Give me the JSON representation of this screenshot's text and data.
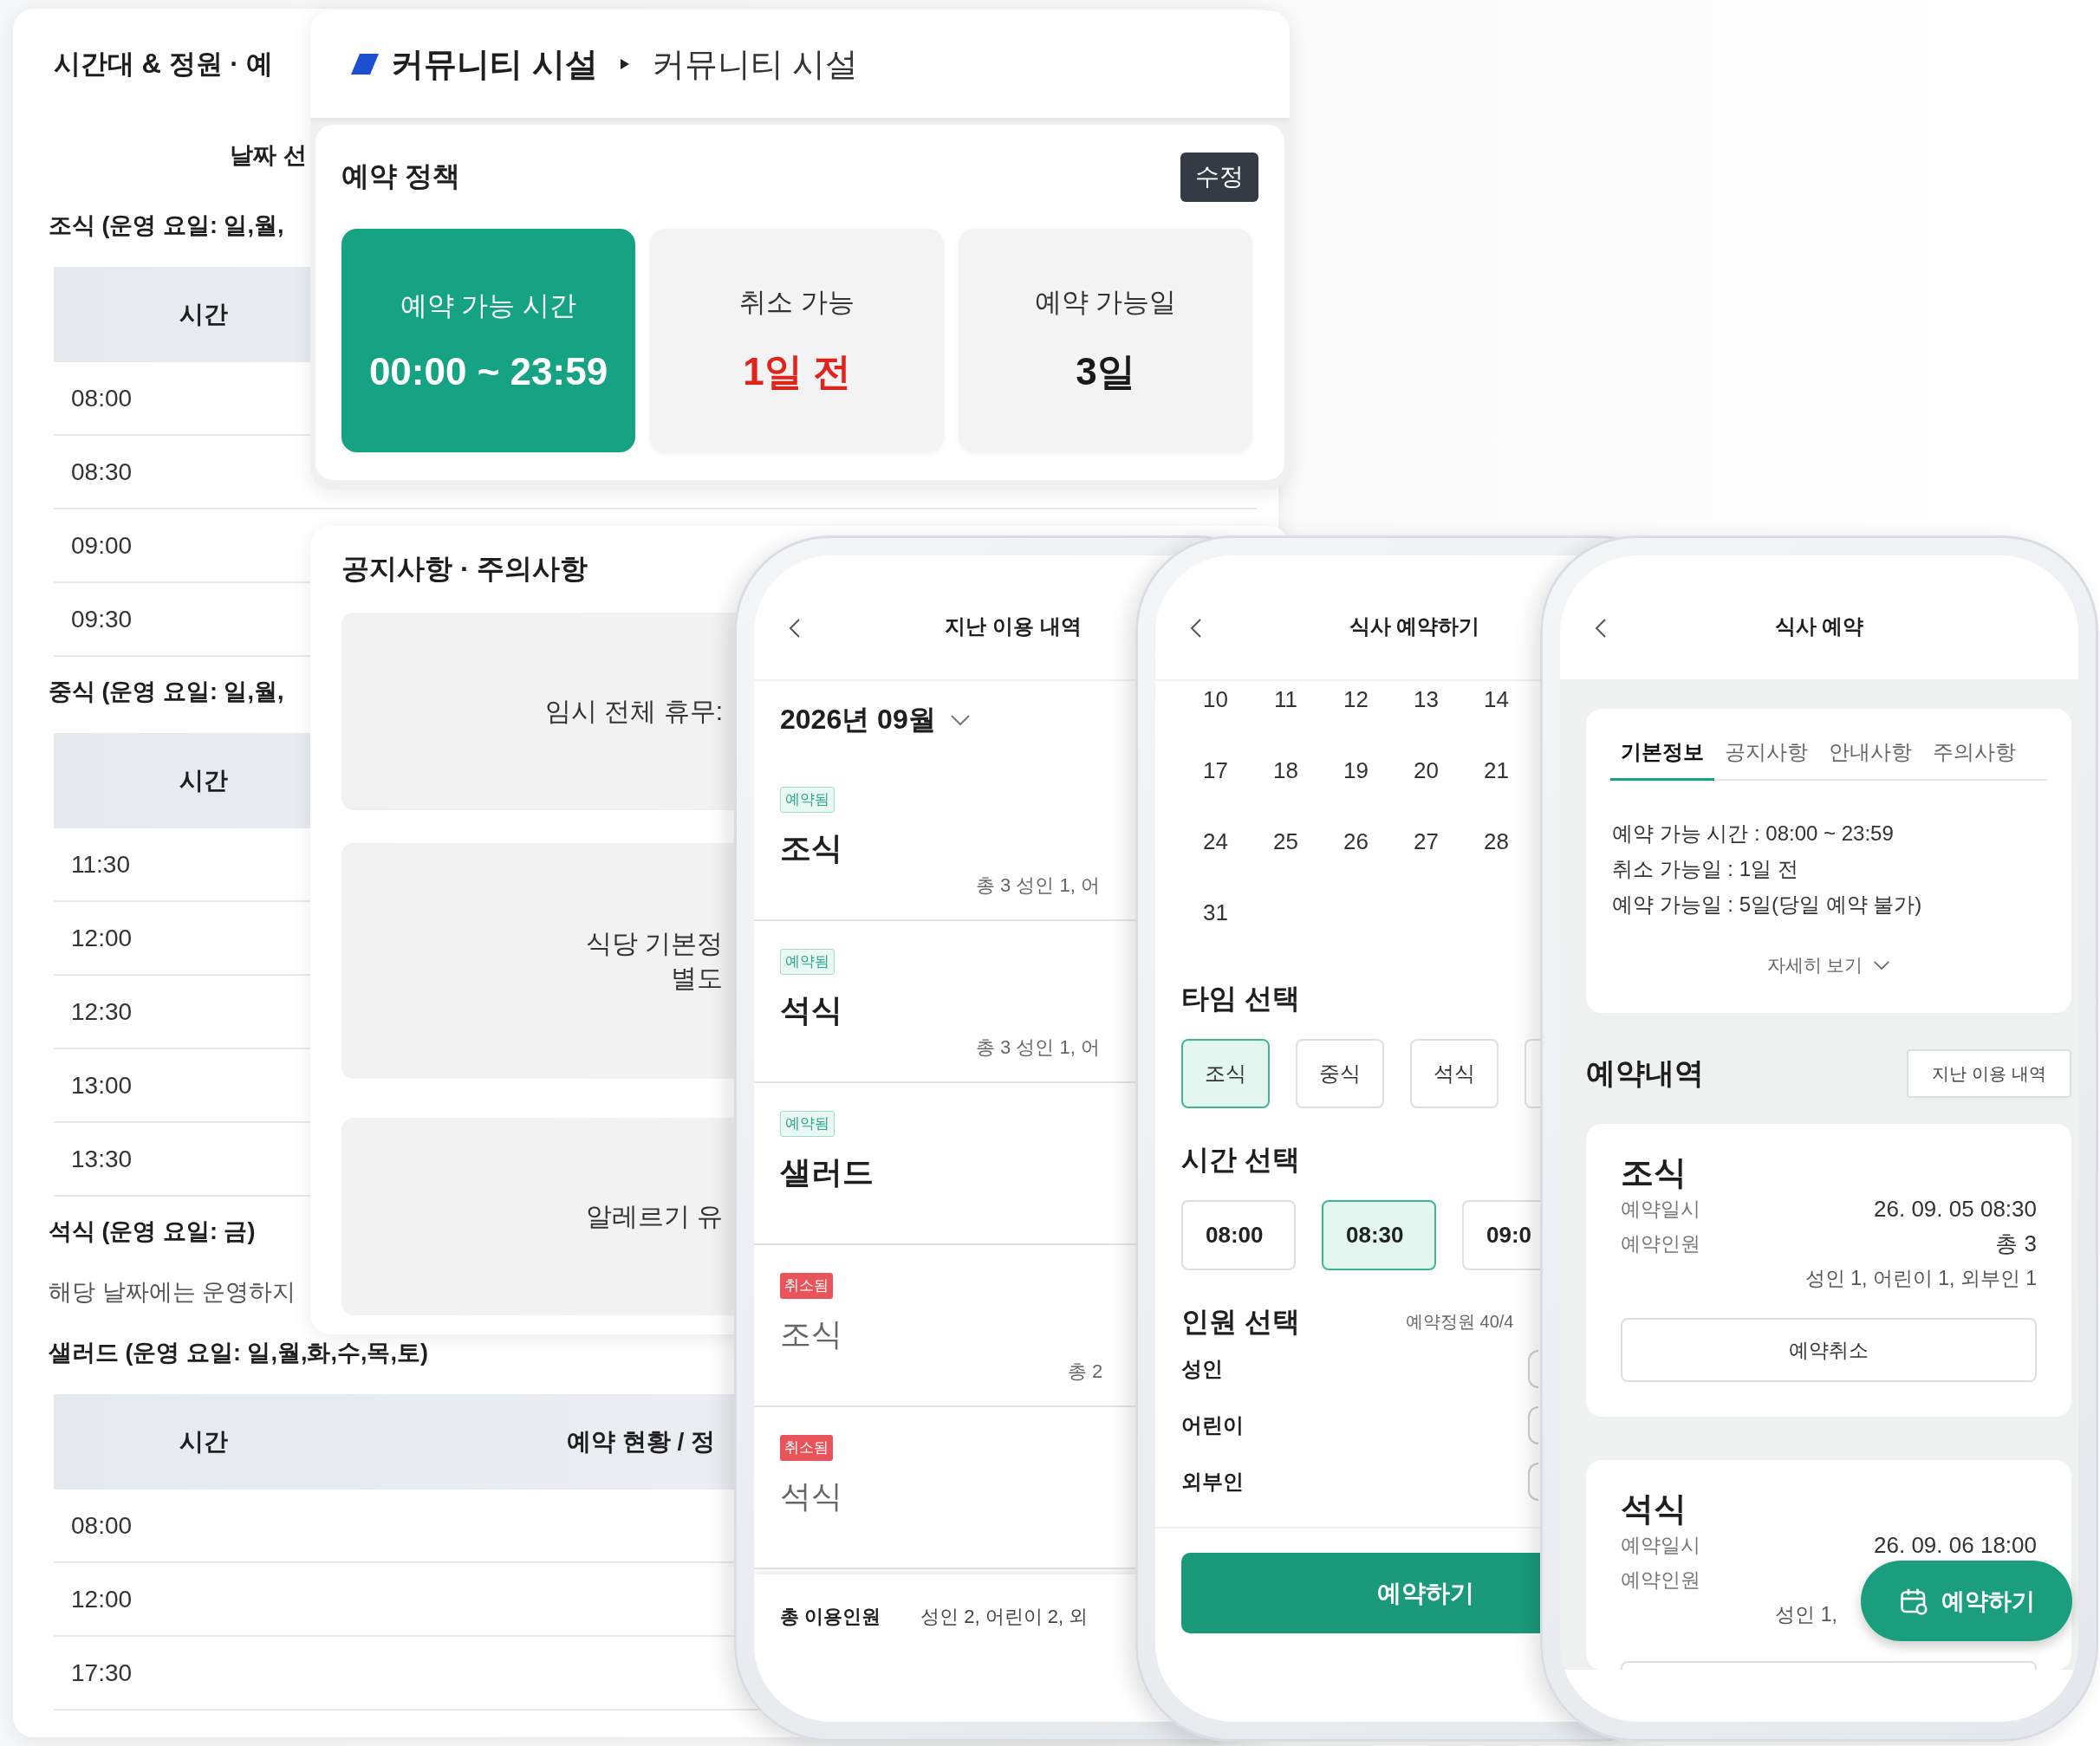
{
  "admin_panel": {
    "title": "시간대 & 정원 · 예",
    "date_label": "날짜 선",
    "sections": [
      {
        "label": "조식 (운영 요일: 일,월,",
        "columns": [
          "시간"
        ],
        "rows": [
          "08:00",
          "08:30",
          "09:00",
          "09:30"
        ]
      },
      {
        "label": "중식 (운영 요일: 일,월,",
        "columns": [
          "시간"
        ],
        "rows": [
          "11:30",
          "12:00",
          "12:30",
          "13:00",
          "13:30"
        ]
      },
      {
        "label": "석식 (운영 요일: 금)",
        "note": "해당 날짜에는 운영하지"
      },
      {
        "label": "샐러드 (운영 요일: 일,월,화,수,목,토)",
        "columns": [
          "시간",
          "예약 현황 / 정"
        ],
        "rows": [
          "08:00",
          "12:00",
          "17:30"
        ]
      }
    ]
  },
  "breadcrumb": [
    "커뮤니티 시설",
    "커뮤니티 시설"
  ],
  "policy": {
    "title": "예약 정책",
    "edit_button": "수정",
    "tiles": [
      {
        "kind": "primary",
        "label": "예약 가능 시간",
        "value": "00:00 ~ 23:59"
      },
      {
        "kind": "alert",
        "label": "취소 가능",
        "value": "1일 전"
      },
      {
        "kind": "plain",
        "label": "예약 가능일",
        "value": "3일"
      }
    ]
  },
  "notices": {
    "title": "공지사항 · 주의사항",
    "items": [
      {
        "lines": [
          "임시 전체 휴무:"
        ]
      },
      {
        "lines": [
          "식당 기본정",
          "별도"
        ]
      },
      {
        "lines": [
          "알레르기 유"
        ]
      }
    ]
  },
  "history_screen": {
    "title": "지난 이용 내역",
    "month": "2026년 09월",
    "items": [
      {
        "badge": "예약됨",
        "cancelled": false,
        "meal": "조식",
        "detail": "총 3  성인 1, 어"
      },
      {
        "badge": "예약됨",
        "cancelled": false,
        "meal": "석식",
        "detail": "총 3  성인 1, 어"
      },
      {
        "badge": "예약됨",
        "cancelled": false,
        "meal": "샐러드"
      },
      {
        "badge": "취소됨",
        "cancelled": true,
        "meal": "조식",
        "detail": "총 2"
      },
      {
        "badge": "취소됨",
        "cancelled": true,
        "meal": "석식"
      }
    ],
    "footer_label": "총 이용인원",
    "footer_value": "성인 2, 어린이 2, 외"
  },
  "booking_screen": {
    "title": "식사 예약하기",
    "calendar_days": [
      "10",
      "11",
      "12",
      "13",
      "14",
      "17",
      "18",
      "19",
      "20",
      "21",
      "24",
      "25",
      "26",
      "27",
      "28",
      "31"
    ],
    "type_title": "타임 선택",
    "types": [
      {
        "label": "조식",
        "selected": true
      },
      {
        "label": "중식",
        "selected": false
      },
      {
        "label": "석식",
        "selected": false
      }
    ],
    "time_title": "시간 선택",
    "times": [
      {
        "label": "08:00",
        "selected": false
      },
      {
        "label": "08:30",
        "selected": true
      },
      {
        "label": "09:0",
        "selected": false
      }
    ],
    "people_title": "인원 선택",
    "capacity": "예약정원 40/4",
    "people": [
      "성인",
      "어린이",
      "외부인"
    ],
    "submit": "예약하기"
  },
  "meal_screen": {
    "title": "식사 예약",
    "tabs": [
      {
        "label": "기본정보",
        "selected": true
      },
      {
        "label": "공지사항",
        "selected": false
      },
      {
        "label": "안내사항",
        "selected": false
      },
      {
        "label": "주의사항",
        "selected": false
      }
    ],
    "info_lines": [
      "예약 가능 시간 : 08:00 ~ 23:59",
      "취소 가능일 : 1일 전",
      "예약 가능일 : 5일(당일 예약 불가)"
    ],
    "more": "자세히 보기",
    "section_title": "예약내역",
    "history_button": "지난 이용 내역",
    "reservations": [
      {
        "meal": "조식",
        "date_label": "예약일시",
        "date": "26. 09. 05  08:30",
        "people_label": "예약인원",
        "total": "총 3",
        "breakdown": "성인 1, 어린이 1, 외부인 1",
        "cancel": "예약취소"
      },
      {
        "meal": "석식",
        "date_label": "예약일시",
        "date": "26. 09. 06  18:00",
        "people_label": "예약인원",
        "breakdown": "성인 1,"
      }
    ],
    "fab": "예약하기"
  }
}
